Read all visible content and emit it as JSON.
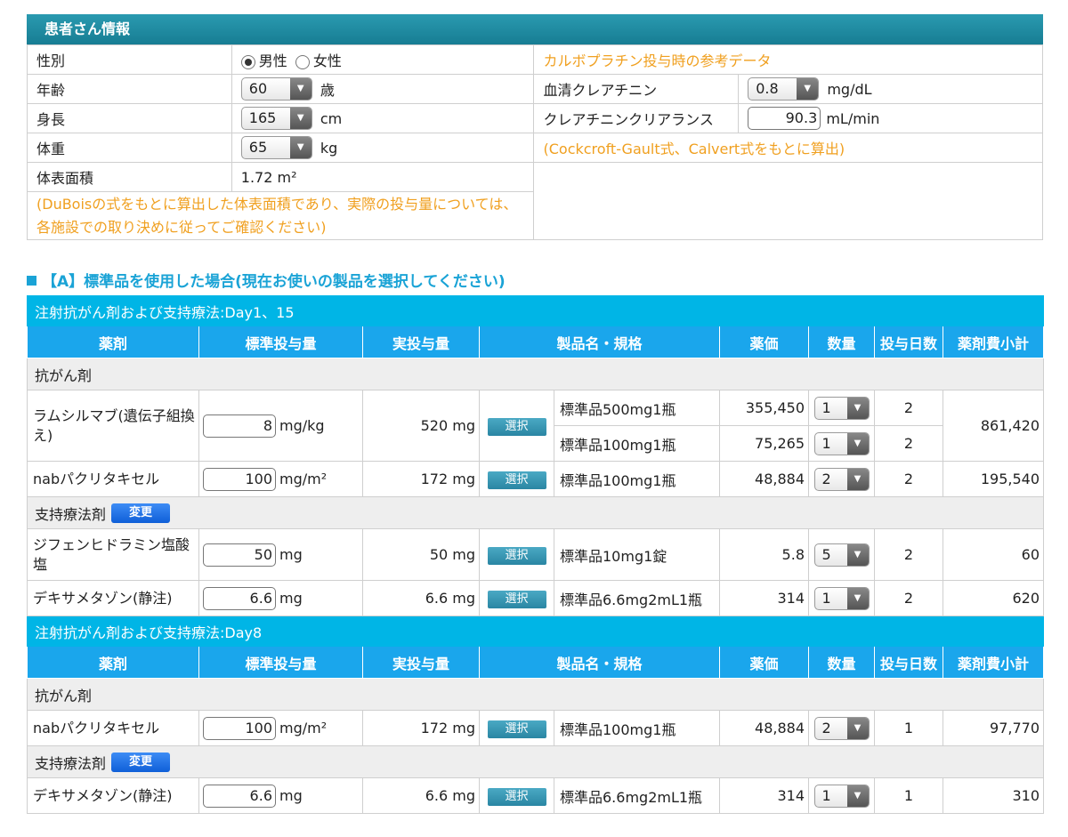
{
  "patient": {
    "title": "患者さん情報",
    "sex_label": "性別",
    "sex_male": "男性",
    "sex_female": "女性",
    "age_label": "年齢",
    "age_value": "60",
    "age_unit": "歳",
    "height_label": "身長",
    "height_value": "165",
    "height_unit": "cm",
    "weight_label": "体重",
    "weight_value": "65",
    "weight_unit": "kg",
    "bsa_label": "体表面積",
    "bsa_value": "1.72 m²",
    "bsa_note_1": "(DuBoisの式をもとに算出した体表面積であり、実際の投与量については、",
    "bsa_note_2": "各施設での取り決めに従ってご確認ください)",
    "carbo_note": "カルボプラチン投与時の参考データ",
    "creat_label": "血清クレアチニン",
    "creat_value": "0.8",
    "creat_unit": "mg/dL",
    "ccr_label": "クレアチニンクリアランス",
    "ccr_value": "90.3",
    "ccr_unit": "mL/min",
    "ccr_note": "(Cockcroft-Gault式、Calvert式をもとに算出)"
  },
  "sectionA": {
    "title": "【A】標準品を使用した場合(現在お使いの製品を選択してください)",
    "headers": [
      "薬剤",
      "標準投与量",
      "実投与量",
      "製品名・規格",
      "薬価",
      "数量",
      "投与日数",
      "薬剤費小計"
    ],
    "select_label": "選択",
    "change_label": "変更",
    "anticancer_label": "抗がん剤",
    "support_label": "支持療法剤",
    "day1": {
      "title": "注射抗がん剤および支持療法:Day1、15",
      "ram": {
        "name": "ラムシルマブ(遺伝子組換え)",
        "std_value": "8",
        "std_unit": "mg/kg",
        "actual": "520 mg",
        "prod1": "標準品500mg1瓶",
        "price1": "355,450",
        "qty1": "1",
        "days1": "2",
        "prod2": "標準品100mg1瓶",
        "price2": "75,265",
        "qty2": "1",
        "days2": "2",
        "subtotal": "861,420"
      },
      "nab": {
        "name": "nabパクリタキセル",
        "std_value": "100",
        "std_unit": "mg/m²",
        "actual": "172 mg",
        "prod": "標準品100mg1瓶",
        "price": "48,884",
        "qty": "2",
        "days": "2",
        "subtotal": "195,540"
      },
      "diph": {
        "name": "ジフェンヒドラミン塩酸塩",
        "std_value": "50",
        "std_unit": "mg",
        "actual": "50 mg",
        "prod": "標準品10mg1錠",
        "price": "5.8",
        "qty": "5",
        "days": "2",
        "subtotal": "60"
      },
      "dexa": {
        "name": "デキサメタゾン(静注)",
        "std_value": "6.6",
        "std_unit": "mg",
        "actual": "6.6 mg",
        "prod": "標準品6.6mg2mL1瓶",
        "price": "314",
        "qty": "1",
        "days": "2",
        "subtotal": "620"
      }
    },
    "day8": {
      "title": "注射抗がん剤および支持療法:Day8",
      "nab": {
        "name": "nabパクリタキセル",
        "std_value": "100",
        "std_unit": "mg/m²",
        "actual": "172 mg",
        "prod": "標準品100mg1瓶",
        "price": "48,884",
        "qty": "2",
        "days": "1",
        "subtotal": "97,770"
      },
      "dexa": {
        "name": "デキサメタゾン(静注)",
        "std_value": "6.6",
        "std_unit": "mg",
        "actual": "6.6 mg",
        "prod": "標準品6.6mg2mL1瓶",
        "price": "314",
        "qty": "1",
        "days": "1",
        "subtotal": "310"
      }
    }
  }
}
